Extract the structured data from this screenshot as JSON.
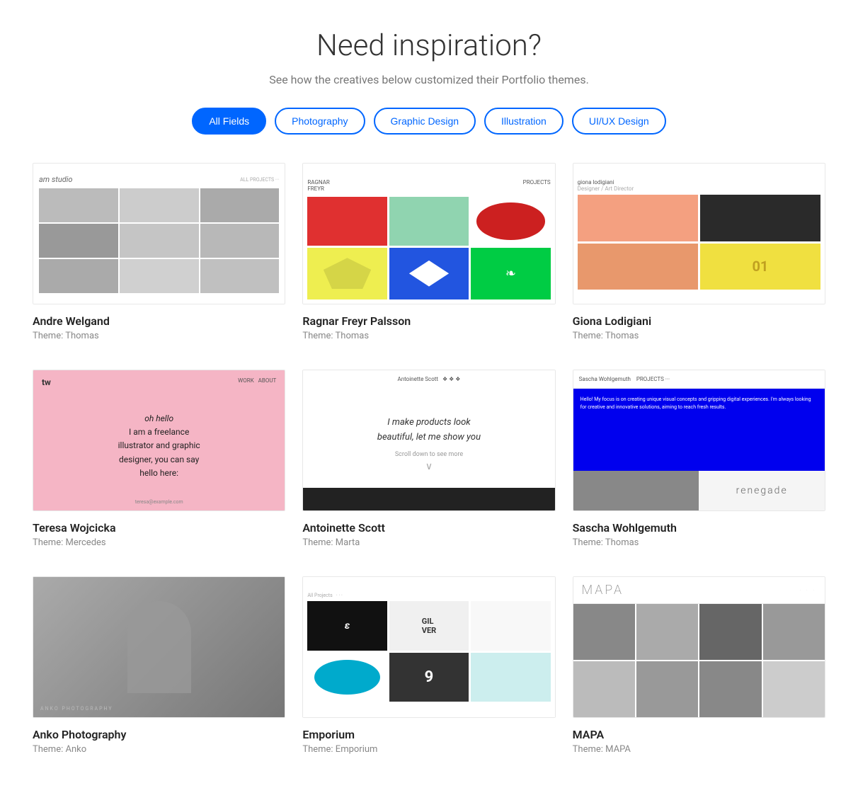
{
  "header": {
    "title": "Need inspiration?",
    "subtitle": "See how the creatives below customized their Portfolio themes."
  },
  "filters": {
    "buttons": [
      {
        "label": "All Fields",
        "active": true
      },
      {
        "label": "Photography",
        "active": false
      },
      {
        "label": "Graphic Design",
        "active": false
      },
      {
        "label": "Illustration",
        "active": false
      },
      {
        "label": "UI/UX Design",
        "active": false
      }
    ]
  },
  "cards": [
    {
      "name": "Andre Welgand",
      "theme_label": "Theme: Thomas",
      "thumb_type": "am-studio"
    },
    {
      "name": "Ragnar Freyr Palsson",
      "theme_label": "Theme: Thomas",
      "thumb_type": "ragnar"
    },
    {
      "name": "Giona Lodigiani",
      "theme_label": "Theme: Thomas",
      "thumb_type": "giona"
    },
    {
      "name": "Teresa Wojcicka",
      "theme_label": "Theme: Mercedes",
      "thumb_type": "teresa"
    },
    {
      "name": "Antoinette Scott",
      "theme_label": "Theme: Marta",
      "thumb_type": "antoinette"
    },
    {
      "name": "Sascha Wohlgemuth",
      "theme_label": "Theme: Thomas",
      "thumb_type": "sascha"
    },
    {
      "name": "Anko Photography",
      "theme_label": "Theme: Anko",
      "thumb_type": "anko"
    },
    {
      "name": "Emporium",
      "theme_label": "Theme: Emporium",
      "thumb_type": "emporium"
    },
    {
      "name": "MAPA",
      "theme_label": "Theme: MAPA",
      "thumb_type": "mapa"
    }
  ],
  "colors": {
    "accent": "#0066ff",
    "text_primary": "#333",
    "text_secondary": "#888"
  }
}
